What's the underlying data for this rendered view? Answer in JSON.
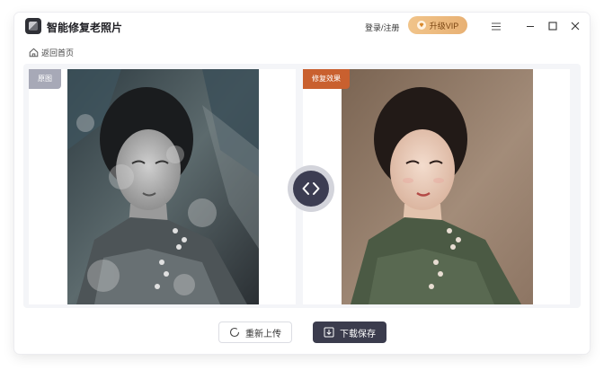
{
  "app": {
    "title": "智能修复老照片"
  },
  "header": {
    "login_label": "登录/注册",
    "vip_label": "升级VIP",
    "vip_icon": "diamond-icon"
  },
  "window_controls": [
    "menu-icon",
    "minimize-icon",
    "maximize-icon",
    "close-icon"
  ],
  "nav": {
    "back_label": "返回首页",
    "back_icon": "home-icon"
  },
  "compare": {
    "original_label": "原图",
    "result_label": "修复效果",
    "handle_icon": "left-right-arrows-icon"
  },
  "actions": {
    "reupload_label": "重新上传",
    "reupload_icon": "refresh-icon",
    "download_label": "下载保存",
    "download_icon": "download-icon"
  },
  "colors": {
    "accent_dark": "#3b3c4d",
    "vip_gold": "#eab877",
    "result_tag": "#c9602f",
    "original_tag": "#a7a9b7"
  }
}
